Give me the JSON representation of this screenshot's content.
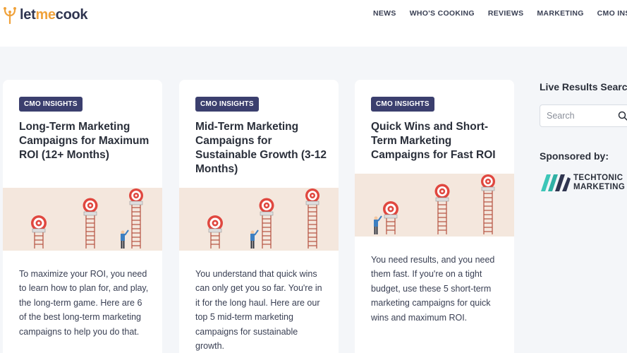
{
  "brand": {
    "logo_part1": "let",
    "logo_part2": "me",
    "logo_part3": "cook",
    "logo_icon": "sprout-icon",
    "accent_color": "#f0a23b",
    "primary_color": "#2f3550"
  },
  "nav": {
    "items": [
      {
        "label": "NEWS"
      },
      {
        "label": "WHO'S COOKING"
      },
      {
        "label": "REVIEWS"
      },
      {
        "label": "MARKETING"
      },
      {
        "label": "CMO INSIGHTS"
      }
    ]
  },
  "cards": [
    {
      "category": "CMO INSIGHTS",
      "title": "Long-Term Marketing Campaigns for Maximum ROI (12+ Months)",
      "excerpt": "To maximize your ROI, you need to learn how to plan for, and play, the long-term game. Here are 6 of the best long-term marketing campaigns to help you do that."
    },
    {
      "category": "CMO INSIGHTS",
      "title": "Mid-Term Marketing Campaigns for Sustainable Growth (3-12 Months)",
      "excerpt": "You understand that quick wins can only get you so far. You're in it for the long haul. Here are our top 5 mid-term marketing campaigns for sustainable growth."
    },
    {
      "category": "CMO INSIGHTS",
      "title": "Quick Wins and Short-Term Marketing Campaigns for Fast ROI",
      "excerpt": "You need results, and you need them fast. If you're on a tight budget, use these 5 short-term marketing campaigns for quick wins and maximum ROI."
    }
  ],
  "sidebar": {
    "search_title": "Live Results Search",
    "search_placeholder": "Search",
    "search_icon": "search-icon",
    "sponsor_title": "Sponsored by:",
    "sponsor_line1": "TECHTONIC",
    "sponsor_line2": "MARKETING"
  },
  "colors": {
    "badge_bg": "#3b3f6e",
    "illustration_bg": "#f4e7dd",
    "target_red": "#e0473f"
  }
}
